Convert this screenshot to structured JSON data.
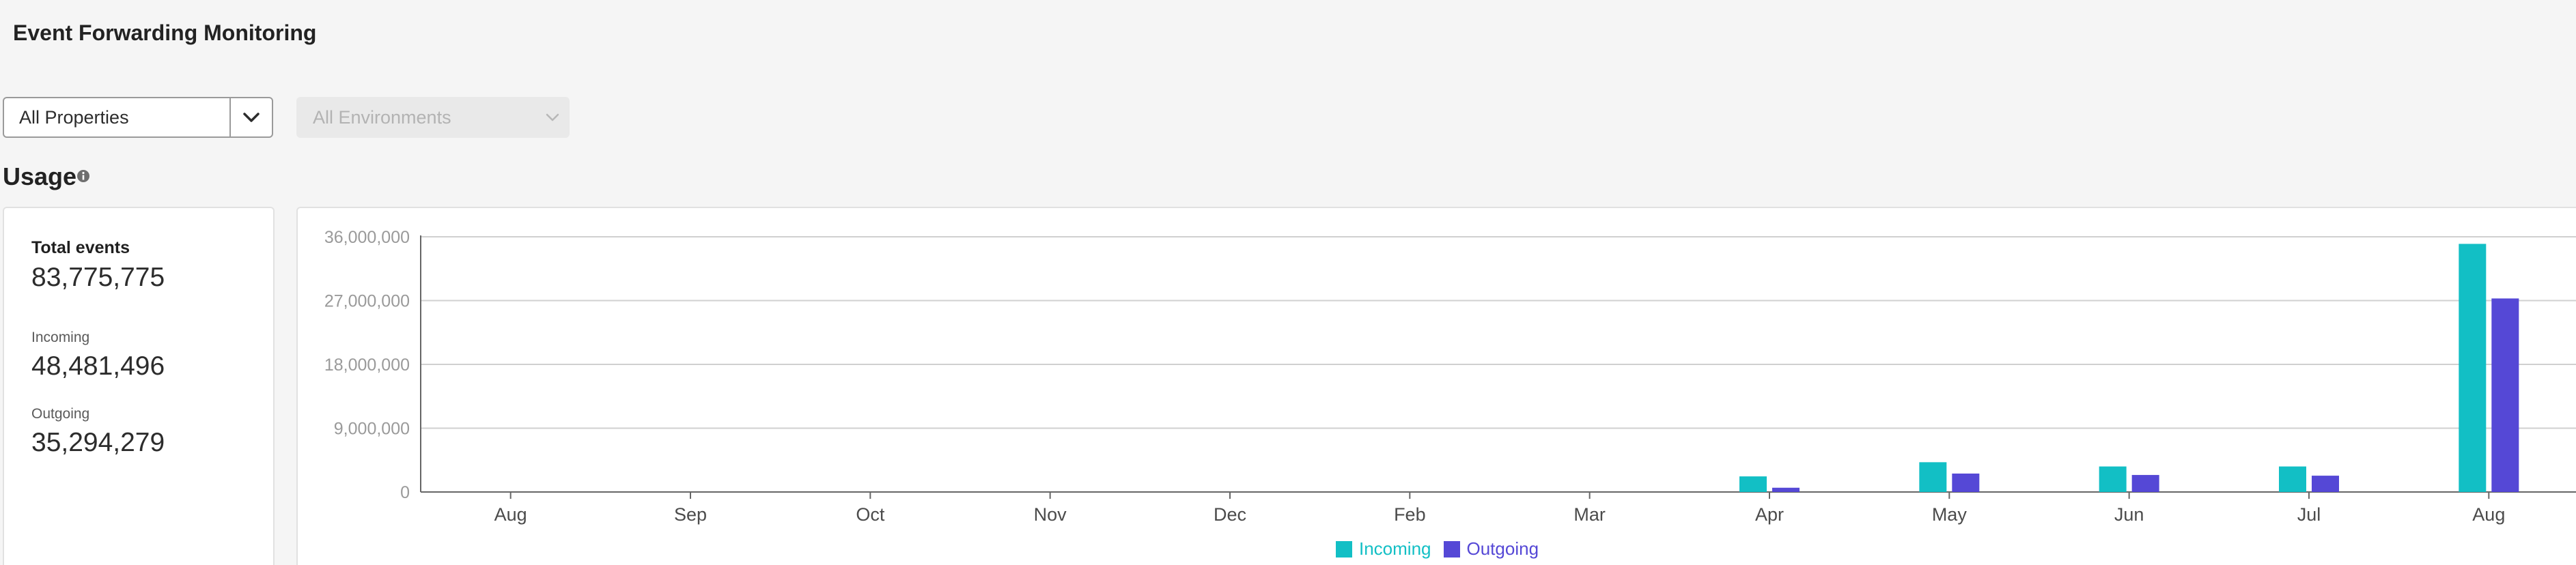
{
  "page": {
    "title": "Event Forwarding Monitoring"
  },
  "filters": {
    "property": "All Properties",
    "environment": "All Environments"
  },
  "usage": {
    "title": "Usage",
    "info_icon": "info-icon",
    "total_label": "Total events",
    "total_value": "83,775,775",
    "incoming_label": "Incoming",
    "incoming_value": "48,481,496",
    "outgoing_label": "Outgoing",
    "outgoing_value": "35,294,279"
  },
  "colors": {
    "incoming": "#12bfc5",
    "outgoing": "#5548d6",
    "grid": "#d0d0d0",
    "axis": "#666666"
  },
  "chart_data": {
    "type": "bar",
    "categories": [
      "Aug",
      "Sep",
      "Oct",
      "Nov",
      "Dec",
      "Feb",
      "Mar",
      "Apr",
      "May",
      "Jun",
      "Jul",
      "Aug"
    ],
    "series": [
      {
        "name": "Incoming",
        "values": [
          0,
          0,
          0,
          0,
          0,
          0,
          0,
          2200000,
          4200000,
          3600000,
          3600000,
          35000000
        ]
      },
      {
        "name": "Outgoing",
        "values": [
          0,
          0,
          0,
          0,
          0,
          0,
          0,
          600000,
          2600000,
          2400000,
          2300000,
          27300000
        ]
      }
    ],
    "yticks": [
      "0",
      "9,000,000",
      "18,000,000",
      "27,000,000",
      "36,000,000"
    ],
    "ylim": [
      0,
      36000000
    ],
    "title": "",
    "xlabel": "",
    "ylabel": "",
    "grid": true,
    "legend_position": "bottom-center"
  }
}
